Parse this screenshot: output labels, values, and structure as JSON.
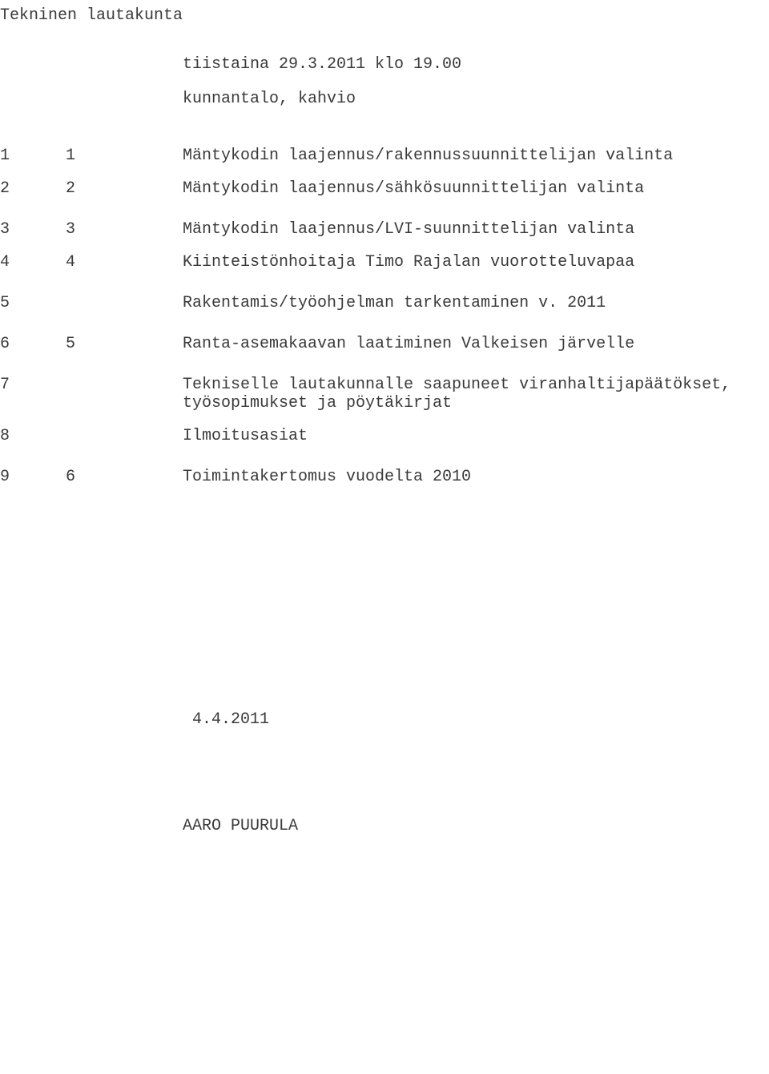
{
  "header": {
    "title": "Tekninen lautakunta",
    "date_line": "tiistaina 29.3.2011 klo 19.00",
    "location": "kunnantalo, kahvio"
  },
  "agenda": [
    {
      "a": "1",
      "b": "1",
      "text": "Mäntykodin laajennus/rakennussuunnittelijan valinta"
    },
    {
      "a": "2",
      "b": "2",
      "text": "Mäntykodin laajennus/sähkösuunnittelijan valinta"
    },
    {
      "a": "3",
      "b": "3",
      "text": "Mäntykodin laajennus/LVI-suunnittelijan valinta"
    },
    {
      "a": "4",
      "b": "4",
      "text": "Kiinteistönhoitaja Timo Rajalan vuorotteluvapaa"
    },
    {
      "a": "5",
      "b": "",
      "text": "Rakentamis/työohjelman tarkentaminen v. 2011"
    },
    {
      "a": "6",
      "b": "5",
      "text": "Ranta-asemakaavan laatiminen Valkeisen järvelle"
    },
    {
      "a": "7",
      "b": "",
      "text": "Tekniselle lautakunnalle saapuneet viranhaltija­päätökset, työsopimukset ja pöytäkirjat"
    },
    {
      "a": "8",
      "b": "",
      "text": "Ilmoitusasiat"
    },
    {
      "a": "9",
      "b": "6",
      "text": "Toimintakertomus vuodelta 2010"
    }
  ],
  "footer": {
    "date": "4.4.2011",
    "signature": "AARO PUURULA"
  }
}
